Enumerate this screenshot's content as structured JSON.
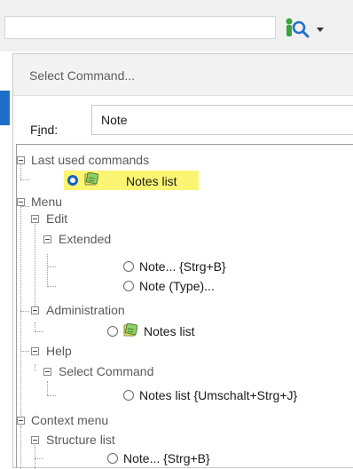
{
  "dialog": {
    "title": "Select Command...",
    "find_label_prefix": "F",
    "find_label_underline": "i",
    "find_label_suffix": "nd:",
    "find_value": "Note"
  },
  "tree": {
    "last_used": {
      "label": "Last used commands",
      "items": [
        {
          "label": "Notes list"
        }
      ]
    },
    "menu": {
      "label": "Menu",
      "edit": {
        "label": "Edit",
        "extended": {
          "label": "Extended",
          "items": [
            {
              "label": "Note... {Strg+B}"
            },
            {
              "label": "Note (Type)..."
            }
          ]
        }
      },
      "administration": {
        "label": "Administration",
        "items": [
          {
            "label": "Notes list"
          }
        ]
      },
      "help": {
        "label": "Help",
        "select_command": {
          "label": "Select Command",
          "items": [
            {
              "label": "Notes list {Umschalt+Strg+J}"
            }
          ]
        }
      }
    },
    "context_menu": {
      "label": "Context menu",
      "structure_list": {
        "label": "Structure list",
        "items": [
          {
            "label": "Note... {Strg+B}"
          }
        ]
      }
    }
  },
  "colors": {
    "selected_radio": "#1262c9",
    "highlight": "#fbf573",
    "accent": "#1e6fc8",
    "search_icon_green": "#3aa33a",
    "search_icon_blue": "#1f6fcf"
  },
  "icons": {
    "search": "search-icon",
    "note": "note-icon"
  }
}
